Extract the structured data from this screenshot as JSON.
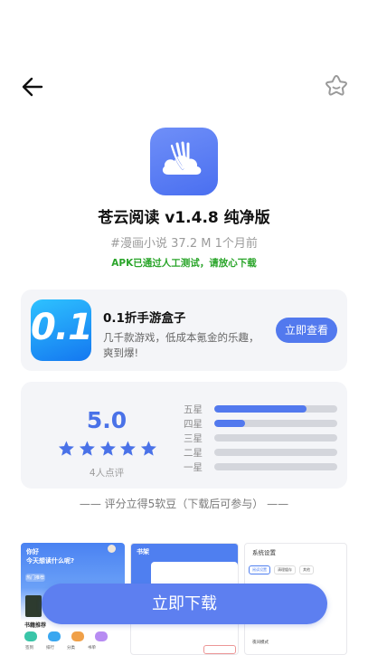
{
  "app": {
    "title": "苍云阅读 v1.4.8 纯净版",
    "meta": "#漫画小说 37.2 M  1个月前",
    "verified": "APK已通过人工测试，请放心下载"
  },
  "promo": {
    "icon_text": "0.1",
    "title": "0.1折手游盒子",
    "desc": "几千款游戏，低成本氪金的乐趣，爽到爆!",
    "button": "立即查看"
  },
  "rating": {
    "score": "5.0",
    "stars": 5,
    "count": "4人点评",
    "bars": [
      {
        "label": "五星",
        "fraction": 0.75
      },
      {
        "label": "四星",
        "fraction": 0.25
      },
      {
        "label": "三星",
        "fraction": 0.0
      },
      {
        "label": "二星",
        "fraction": 0.0
      },
      {
        "label": "一星",
        "fraction": 0.0
      }
    ]
  },
  "rate_hint": "—— 评分立得5软豆（下载后可参与） ——",
  "screenshots": {
    "shot1": {
      "greeting": "你好",
      "question": "今天想读什么呢?",
      "chip": "热门推荐",
      "section": "书籍推荐",
      "tabs": [
        "签到",
        "排行",
        "分类",
        "书单"
      ]
    },
    "shot2": {
      "header": "书架"
    },
    "shot3": {
      "header": "系统设置",
      "tabs": [
        "阅读设置",
        "清理缓存",
        "其他"
      ],
      "item": "夜间模式"
    }
  },
  "download_button": "立即下载",
  "icons": {
    "back": "arrow-left-icon",
    "favorite": "star-outline-icon"
  },
  "colors": {
    "accent": "#5279ee",
    "verified": "#2aa52a",
    "card_bg": "#f4f5f8"
  }
}
